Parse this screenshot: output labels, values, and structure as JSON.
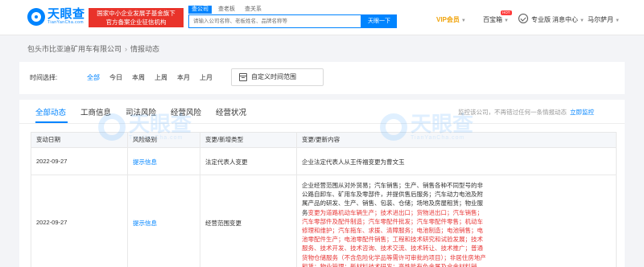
{
  "header": {
    "logo_text": "天眼查",
    "logo_sub": "TianYanCha.com",
    "gov_badge_line1": "国家中小企业发展子基金旗下",
    "gov_badge_line2": "官方备案企业征信机构",
    "search_tabs": [
      "查公司",
      "查老板",
      "查关系"
    ],
    "search_placeholder": "请输入公司名称、老板姓名、品牌名称等",
    "search_button": "天眼一下",
    "vip_label": "VIP会员",
    "baixin_label": "百宝箱",
    "hot_badge": "HOT",
    "pro_label": "专业版",
    "message_label": "消息中心",
    "user_name": "马尔萨月"
  },
  "breadcrumb": {
    "company": "包头市比亚迪矿用车有限公司",
    "current": "情报动态"
  },
  "filter": {
    "label": "时间选择:",
    "options": [
      "全部",
      "今日",
      "本周",
      "上周",
      "本月",
      "上月"
    ],
    "custom_range": "自定义时间范围"
  },
  "tabs": [
    "全部动态",
    "工商信息",
    "司法风险",
    "经营风险",
    "经营状况"
  ],
  "monitor": {
    "text": "监控该公司，不再错过任何一条情报动态",
    "link": "立即监控"
  },
  "table": {
    "headers": [
      "变动日期",
      "风险级别",
      "变更/新增类型",
      "变更/更新内容"
    ],
    "rows": [
      {
        "date": "2022-09-27",
        "level": "提示信息",
        "type": "法定代表人变更",
        "content": "企业法定代表人从王传福变更为曹文玉"
      },
      {
        "date": "2022-09-27",
        "level": "提示信息",
        "type": "经营范围变更",
        "content_segments": [
          {
            "t": "企业经营范围从对外贸易；汽车销售；生产、销售各种不同型号的非公路自卸车、矿用车及零部件，并提供售后服务；",
            "hl": false
          },
          {
            "t": "汽车动力电池及附属产品的研发、生产、销售、包装、仓储；场地及房屋租赁；物业服务",
            "hl": false
          },
          {
            "t": "变更为道路机动车辆生产；技术进出口；货物进出口；汽车销售；汽车零部件及配件制造；汽车零配件批发；汽车零配件零售；机动车修理和维护；汽车拖车、求援、清障服务；电池制造；电池销售；电池零配件生产；电池零配件销售；工程和技术研究和试验发展；技术服务、技术开发、技术咨询、技术交流、技术转让、技术推广；普通货物仓储服务（不含危险化学品等需许可审批的项目）；非居住房地产租赁；物业管理；新材料技术研发；高性能有色金属及合金材料销售；有色金属压延加工",
            "hl": true
          }
        ]
      }
    ]
  },
  "watermark": {
    "cn": "天眼查",
    "en": "TianYanCha.com"
  },
  "colors": {
    "brand": "#0084ff",
    "badge_red": "#e9332a",
    "highlight_red": "#e83737",
    "vip_gold": "#f0a30a"
  }
}
